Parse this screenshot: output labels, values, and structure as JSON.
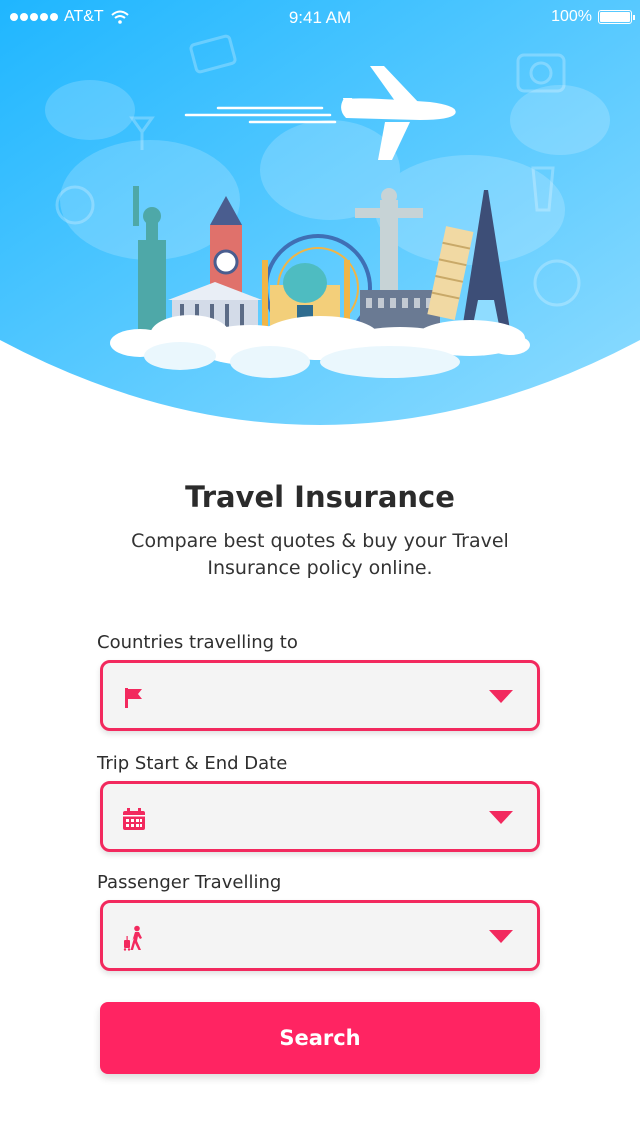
{
  "status_bar": {
    "carrier": "AT&T",
    "time": "9:41 AM",
    "battery": "100%"
  },
  "colors": {
    "accent": "#ff2462",
    "sky_light": "#7fd3ff",
    "sky_dark": "#1fb6ff"
  },
  "header": {
    "title": "Travel Insurance",
    "subtitle_line1": "Compare best quotes & buy your Travel",
    "subtitle_line2": "Insurance policy online."
  },
  "form": {
    "countries": {
      "label": "Countries travelling to",
      "icon": "flag-icon",
      "value": ""
    },
    "dates": {
      "label": "Trip Start & End Date",
      "icon": "calendar-icon",
      "value": ""
    },
    "passengers": {
      "label": "Passenger Travelling",
      "icon": "traveler-icon",
      "value": ""
    },
    "search_label": "Search"
  }
}
